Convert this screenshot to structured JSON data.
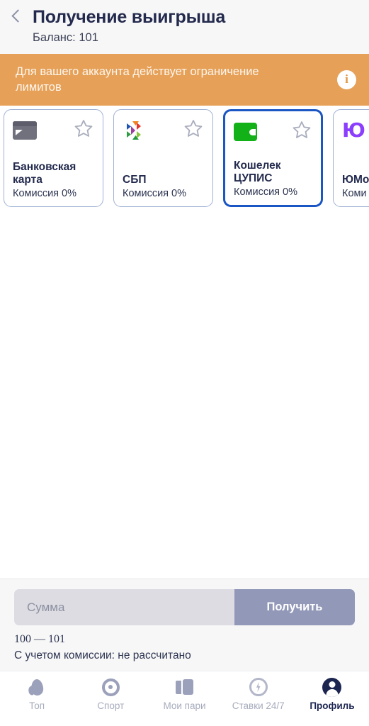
{
  "header": {
    "back_icon": "chevron-left-icon",
    "title": "Получение выигрыша",
    "balance_label": "Баланс: 101"
  },
  "banner": {
    "text": "Для вашего аккаунта действует ограничение лимитов",
    "info_icon": "info-icon",
    "background_color": "#e6a057",
    "text_color": "#fdf6ee"
  },
  "payment_methods": [
    {
      "name": "Банковская\nкарта",
      "fee": "Комиссия 0%",
      "icon": "bank-card-icon",
      "favorite_icon": "star-outline-icon",
      "selected": false
    },
    {
      "name": "СБП",
      "fee": "Комиссия 0%",
      "icon": "sbp-logo-icon",
      "favorite_icon": "star-outline-icon",
      "selected": false
    },
    {
      "name": "Кошелек\nЦУПИС",
      "fee": "Комиссия 0%",
      "icon": "wallet-icon",
      "favorite_icon": "star-outline-icon",
      "selected": true
    },
    {
      "name": "ЮМо",
      "fee": "Коми",
      "icon": "yoomoney-logo-icon",
      "favorite_icon": "star-outline-icon",
      "selected": false
    }
  ],
  "selection_accent_color": "#1a56c4",
  "amount_panel": {
    "input_placeholder": "Сумма",
    "input_value": "",
    "submit_label": "Получить",
    "range_text": "100 — 101",
    "commission_text": "С учетом комиссии: не рассчитано"
  },
  "bottom_nav": {
    "items": [
      {
        "label": "Топ",
        "icon": "flame-icon",
        "active": false
      },
      {
        "label": "Спорт",
        "icon": "target-icon",
        "active": false
      },
      {
        "label": "Мои пари",
        "icon": "ticket-icon",
        "active": false
      },
      {
        "label": "Ставки 24/7",
        "icon": "bolt-circle-icon",
        "active": false
      },
      {
        "label": "Профиль",
        "icon": "person-icon",
        "active": true
      }
    ]
  }
}
